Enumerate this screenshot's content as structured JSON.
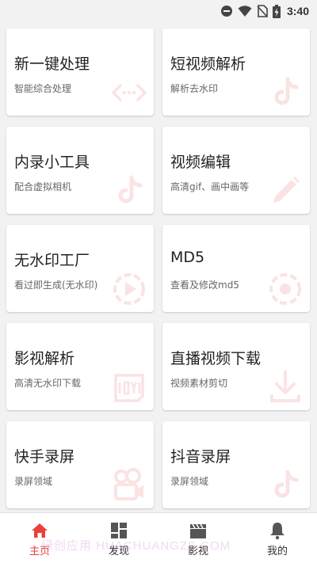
{
  "status_bar": {
    "time": "3:40",
    "icons": [
      "do-not-disturb-icon",
      "wifi-icon",
      "no-sim-icon",
      "battery-charging-icon"
    ]
  },
  "cards": [
    {
      "title": "新一键处理",
      "subtitle": "智能综合处理",
      "icon": "code-brackets-icon"
    },
    {
      "title": "短视频解析",
      "subtitle": "解析去水印",
      "icon": "tiktok-icon"
    },
    {
      "title": "内录小工具",
      "subtitle": "配合虚拟相机",
      "icon": "tiktok-icon"
    },
    {
      "title": "视频编辑",
      "subtitle": "高清gif、画中画等",
      "icon": "pencil-icon"
    },
    {
      "title": "无水印工厂",
      "subtitle": "看过即生成(无水印)",
      "icon": "play-circle-icon"
    },
    {
      "title": "MD5",
      "subtitle": "查看及修改md5",
      "icon": "record-circle-icon"
    },
    {
      "title": "影视解析",
      "subtitle": "高清无水印下载",
      "icon": "iqiyi-icon"
    },
    {
      "title": "直播视频下载",
      "subtitle": "视频素材剪切",
      "icon": "download-icon"
    },
    {
      "title": "快手录屏",
      "subtitle": "录屏领域",
      "icon": "kuaishou-camera-icon"
    },
    {
      "title": "抖音录屏",
      "subtitle": "录屏领域",
      "icon": "tiktok-icon"
    }
  ],
  "nav": [
    {
      "label": "主页",
      "icon": "home-icon",
      "active": true
    },
    {
      "label": "发现",
      "icon": "dashboard-icon",
      "active": false
    },
    {
      "label": "影视",
      "icon": "clapperboard-icon",
      "active": false
    },
    {
      "label": "我的",
      "icon": "bell-icon",
      "active": false
    }
  ],
  "watermark": "绿创应用 HUACHUANGZS.COM",
  "colors": {
    "accent": "#e8413c",
    "icon_faint": "#fbe3e3",
    "background": "#f2f2f2",
    "card": "#ffffff"
  }
}
